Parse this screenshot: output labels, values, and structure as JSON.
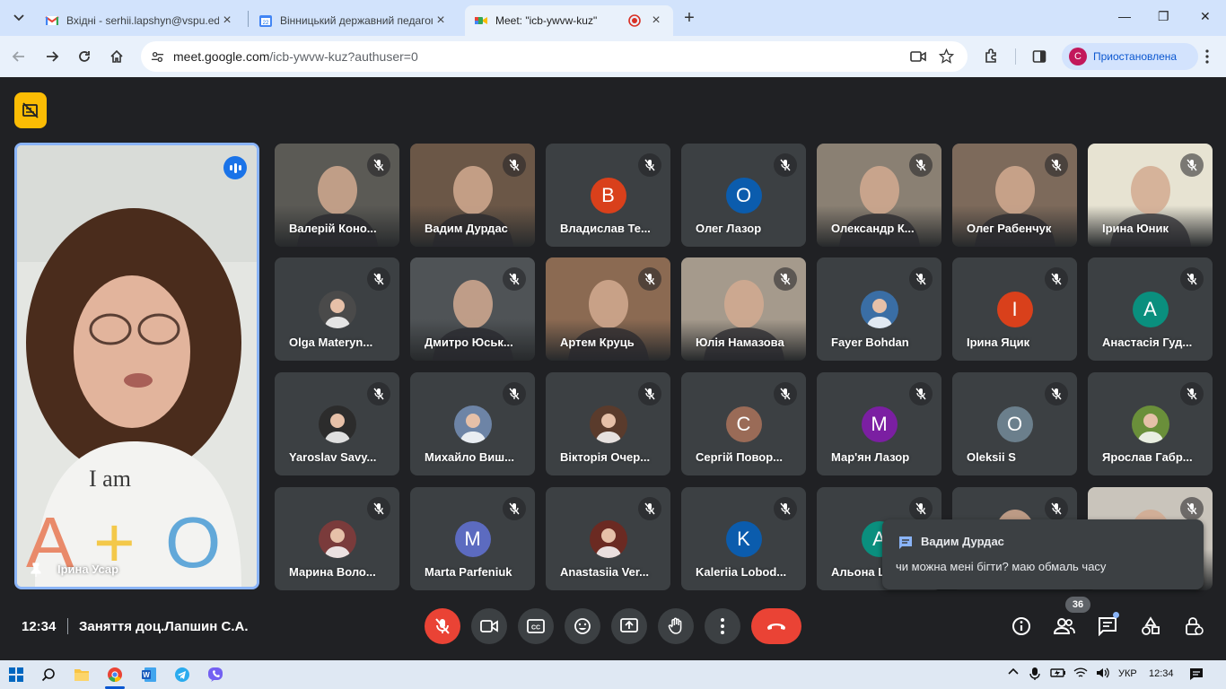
{
  "browser": {
    "tabs": [
      {
        "title": "Вхідні - serhii.lapshyn@vspu.edu.ua",
        "favicon": "gmail-icon",
        "active": false
      },
      {
        "title": "Вінницький державний педагогічний",
        "favicon": "calendar-icon",
        "active": false
      },
      {
        "title": "Meet: \"icb-ywvw-kuz\"",
        "favicon": "meet-icon",
        "active": true
      }
    ],
    "url_host": "meet.google.com",
    "url_path": "/icb-ywvw-kuz?authuser=0",
    "profile_initial": "C",
    "profile_label": "Приостановлена"
  },
  "meet": {
    "pinned": {
      "name": "Ірина Усар"
    },
    "participants": [
      {
        "name": "Валерій Коно...",
        "kind": "video",
        "bg": "#5b5a55"
      },
      {
        "name": "Вадим Дурдас",
        "kind": "video",
        "bg": "#6b5747"
      },
      {
        "name": "Владислав Те...",
        "kind": "letter",
        "letter": "В",
        "color": "#d9401b"
      },
      {
        "name": "Олег Лазор",
        "kind": "letter",
        "letter": "О",
        "color": "#0b5cad"
      },
      {
        "name": "Олександр К...",
        "kind": "video",
        "bg": "#8a8073"
      },
      {
        "name": "Олег Рабенчук",
        "kind": "video",
        "bg": "#7d6a5b"
      },
      {
        "name": "Ірина Юник",
        "kind": "video",
        "bg": "#e7e3d2"
      },
      {
        "name": "Olga Materyn...",
        "kind": "avatar",
        "color": "#4a4a4a"
      },
      {
        "name": "Дмитро Юськ...",
        "kind": "video",
        "bg": "#4f5356"
      },
      {
        "name": "Артем Круць",
        "kind": "video",
        "bg": "#8b6a52"
      },
      {
        "name": "Юлія Намазова",
        "kind": "video",
        "bg": "#a59a8c"
      },
      {
        "name": "Fayer Bohdan",
        "kind": "avatar",
        "color": "#3a6ea5"
      },
      {
        "name": "Ірина Яцик",
        "kind": "letter",
        "letter": "І",
        "color": "#d9401b"
      },
      {
        "name": "Анастасія Гуд...",
        "kind": "letter",
        "letter": "А",
        "color": "#0a8f7e"
      },
      {
        "name": "Yaroslav Savy...",
        "kind": "avatar",
        "color": "#2c2c2c"
      },
      {
        "name": "Михайло Виш...",
        "kind": "avatar",
        "color": "#6d84a6"
      },
      {
        "name": "Вікторія Очер...",
        "kind": "avatar",
        "color": "#5a3b2c"
      },
      {
        "name": "Сергій Повор...",
        "kind": "letter",
        "letter": "С",
        "color": "#9a6b57"
      },
      {
        "name": "Мар'ян Лазор",
        "kind": "letter",
        "letter": "М",
        "color": "#7b1fa2"
      },
      {
        "name": "Oleksii S",
        "kind": "letter",
        "letter": "O",
        "color": "#6b7f8c"
      },
      {
        "name": "Ярослав Габр...",
        "kind": "avatar",
        "color": "#6a8f3a"
      },
      {
        "name": "Марина Воло...",
        "kind": "avatar",
        "color": "#7a3b3b"
      },
      {
        "name": "Marta Parfeniuk",
        "kind": "letter",
        "letter": "M",
        "color": "#5c6bc0"
      },
      {
        "name": "Anastasiia Ver...",
        "kind": "avatar",
        "color": "#6b2a22"
      },
      {
        "name": "Kaleriia Lobod...",
        "kind": "letter",
        "letter": "K",
        "color": "#0b5cad"
      },
      {
        "name": "Альона Ш",
        "kind": "letter",
        "letter": "А",
        "color": "#0a8f7e"
      },
      {
        "name": "",
        "kind": "video",
        "bg": "#3c4043"
      },
      {
        "name": "",
        "kind": "video",
        "bg": "#c9c4bb"
      }
    ],
    "chat_toast": {
      "sender": "Вадим Дурдас",
      "message": "чи можна мені бігти? маю обмаль часу"
    },
    "time": "12:34",
    "meeting_title": "Заняття доц.Лапшин С.А.",
    "participants_count": "36"
  },
  "taskbar": {
    "lang": "УКР",
    "time": "12:34"
  }
}
